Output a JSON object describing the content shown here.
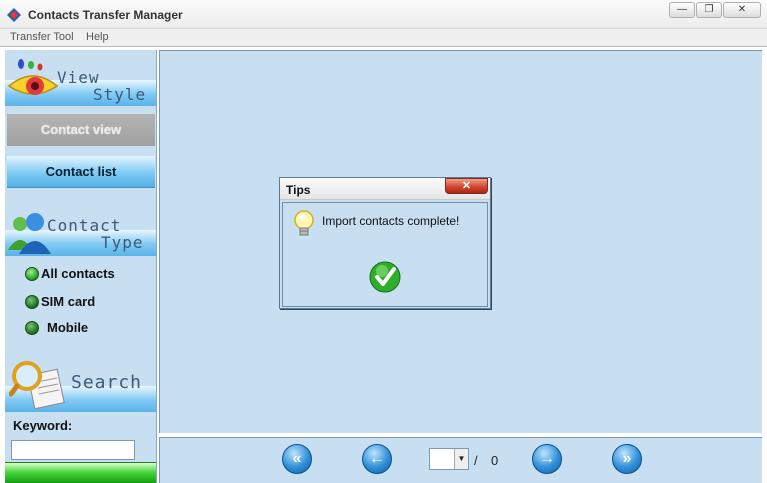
{
  "window": {
    "title": "Contacts Transfer Manager",
    "minimize_label": "—",
    "maximize_label": "❐",
    "close_label": "✕"
  },
  "menu": {
    "items": [
      "Transfer Tool",
      "Help"
    ]
  },
  "sidebar": {
    "view_style": {
      "title_line1": "View",
      "title_line2": "Style"
    },
    "contact_view_label": "Contact view",
    "contact_list_label": "Contact list",
    "contact_type": {
      "title_line1": "Contact",
      "title_line2": "Type"
    },
    "filters": [
      "All contacts",
      "SIM card",
      "Mobile"
    ],
    "search": {
      "title": "Search"
    },
    "keyword_label": "Keyword:",
    "keyword_value": ""
  },
  "dialog": {
    "title": "Tips",
    "close_label": "✕",
    "message": "Import contacts complete!"
  },
  "pager": {
    "current_page": "",
    "separator": "/",
    "total_pages": "0",
    "first_symbol": "«",
    "prev_symbol": "←",
    "next_symbol": "→",
    "last_symbol": "»"
  },
  "icons": {
    "app": "app-icon",
    "view_style": "eye-icon",
    "contact_type": "people-icon",
    "search": "magnifier-icon",
    "tips": "lightbulb-icon",
    "complete": "green-check-icon"
  },
  "colors": {
    "panel_bg": "#c8dff2",
    "blue_button": "#7ccaf4",
    "gray_button": "#a8a8a8",
    "green": "#22a524",
    "close_red": "#d2462c"
  }
}
